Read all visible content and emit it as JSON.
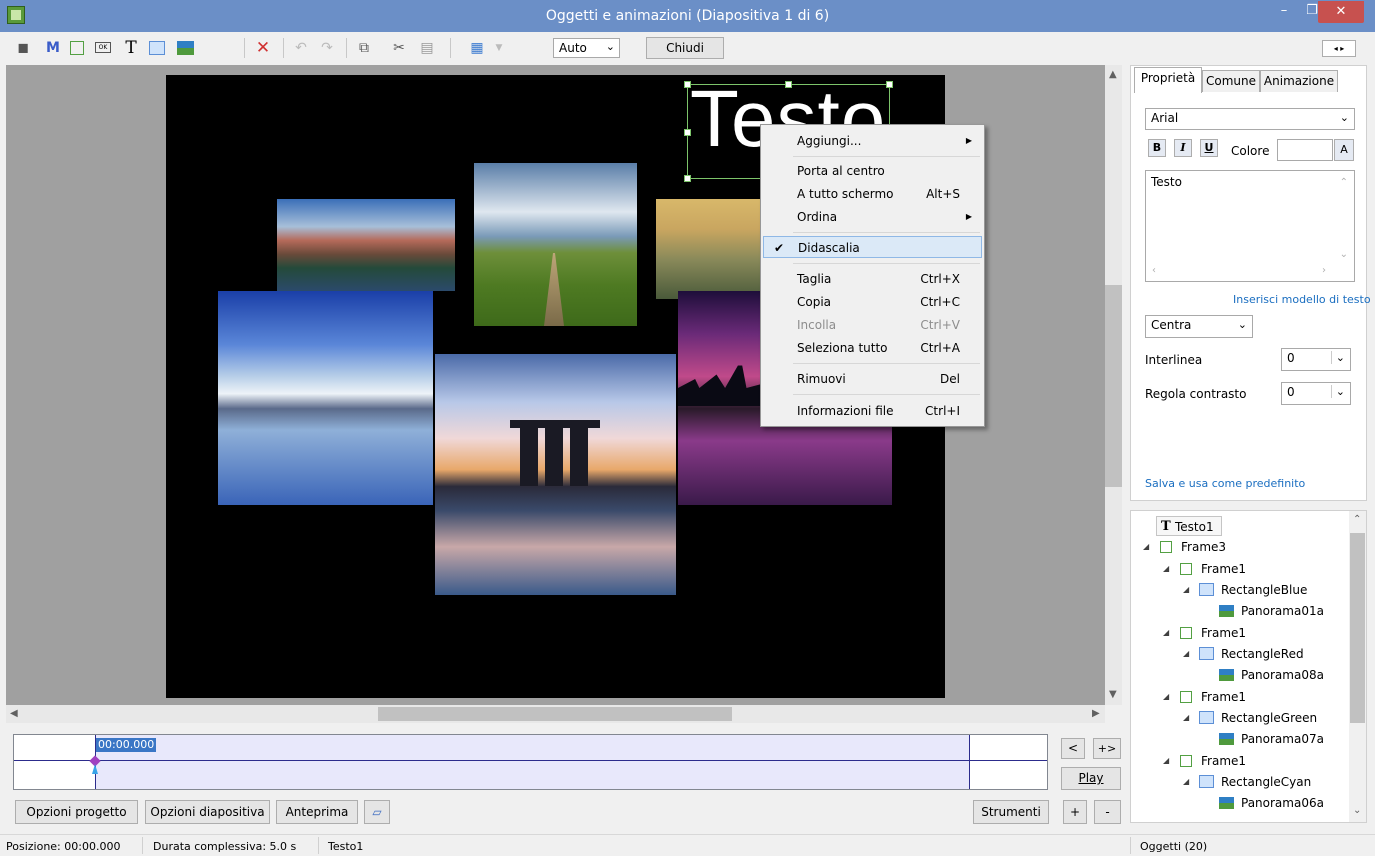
{
  "window": {
    "title": "Oggetti e animazioni  (Diapositiva 1 di 6)",
    "min_label": "–",
    "max_label": "❐",
    "close_label": "✕"
  },
  "toolbar": {
    "icons": [
      "camera-icon",
      "mask-icon",
      "frame-icon",
      "button-icon",
      "text-icon",
      "rectangle-icon",
      "image-icon",
      "delete-icon",
      "undo-icon",
      "redo-icon",
      "duplicate-icon",
      "cut-icon",
      "paste-icon",
      "grid-icon"
    ],
    "m_label": "M",
    "ok_label": "OK",
    "t_label": "T",
    "zoom_value": "Auto",
    "close_button": "Chiudi"
  },
  "slide": {
    "text_object": "Testo"
  },
  "context_menu": {
    "items": [
      {
        "label": "Aggiungi...",
        "shortcut": "",
        "submenu": true
      },
      {
        "label": "Porta al centro",
        "shortcut": ""
      },
      {
        "label": "A tutto schermo",
        "shortcut": "Alt+S"
      },
      {
        "label": "Ordina",
        "shortcut": "",
        "submenu": true
      },
      {
        "label": "Didascalia",
        "shortcut": "",
        "checked": true
      },
      {
        "label": "Taglia",
        "shortcut": "Ctrl+X"
      },
      {
        "label": "Copia",
        "shortcut": "Ctrl+C"
      },
      {
        "label": "Incolla",
        "shortcut": "Ctrl+V",
        "disabled": true
      },
      {
        "label": "Seleziona tutto",
        "shortcut": "Ctrl+A"
      },
      {
        "label": "Rimuovi",
        "shortcut": "Del"
      },
      {
        "label": "Informazioni file",
        "shortcut": "Ctrl+I"
      }
    ]
  },
  "timeline": {
    "time": "00:00.000",
    "prev_btn": "<",
    "next_btn": "+>",
    "play_btn": "Play",
    "plus_btn": "+",
    "minus_btn": "-"
  },
  "bottom_buttons": {
    "project_options": "Opzioni progetto",
    "slide_options": "Opzioni diapositiva",
    "preview": "Anteprima",
    "tools": "Strumenti"
  },
  "status": {
    "position": "Posizione: 00:00.000",
    "duration": "Durata complessiva: 5.0 s",
    "selected": "Testo1",
    "objects": "Oggetti (20)"
  },
  "properties": {
    "tabs": [
      "Proprietà",
      "Comune",
      "Animazione"
    ],
    "font": "Arial",
    "bold": "B",
    "italic": "I",
    "underline": "U",
    "color_label": "Colore",
    "color_btn": "A",
    "text_value": "Testo",
    "template_link": "Inserisci modello di testo",
    "align": "Centra",
    "line_spacing_label": "Interlinea",
    "line_spacing_value": "0",
    "contrast_label": "Regola contrasto",
    "contrast_value": "0",
    "save_default": "Salva e usa come predefinito"
  },
  "tree": {
    "items": [
      {
        "label": "Testo1",
        "icon": "text-icon",
        "level": 0
      },
      {
        "label": "Frame3",
        "icon": "frame-icon",
        "level": 0
      },
      {
        "label": "Frame1",
        "icon": "frame-icon",
        "level": 1
      },
      {
        "label": "RectangleBlue",
        "icon": "rectangle-icon",
        "level": 2
      },
      {
        "label": "Panorama01a",
        "icon": "image-icon",
        "level": 3
      },
      {
        "label": "Frame1",
        "icon": "frame-icon",
        "level": 1
      },
      {
        "label": "RectangleRed",
        "icon": "rectangle-icon",
        "level": 2
      },
      {
        "label": "Panorama08a",
        "icon": "image-icon",
        "level": 3
      },
      {
        "label": "Frame1",
        "icon": "frame-icon",
        "level": 1
      },
      {
        "label": "RectangleGreen",
        "icon": "rectangle-icon",
        "level": 2
      },
      {
        "label": "Panorama07a",
        "icon": "image-icon",
        "level": 3
      },
      {
        "label": "Frame1",
        "icon": "frame-icon",
        "level": 1
      },
      {
        "label": "RectangleCyan",
        "icon": "rectangle-icon",
        "level": 2
      },
      {
        "label": "Panorama06a",
        "icon": "image-icon",
        "level": 3
      }
    ]
  },
  "colors": {
    "titlebar": "#6b8fc7",
    "close": "#c7514f",
    "selection": "#7cc46a",
    "link": "#1a6ec0"
  }
}
